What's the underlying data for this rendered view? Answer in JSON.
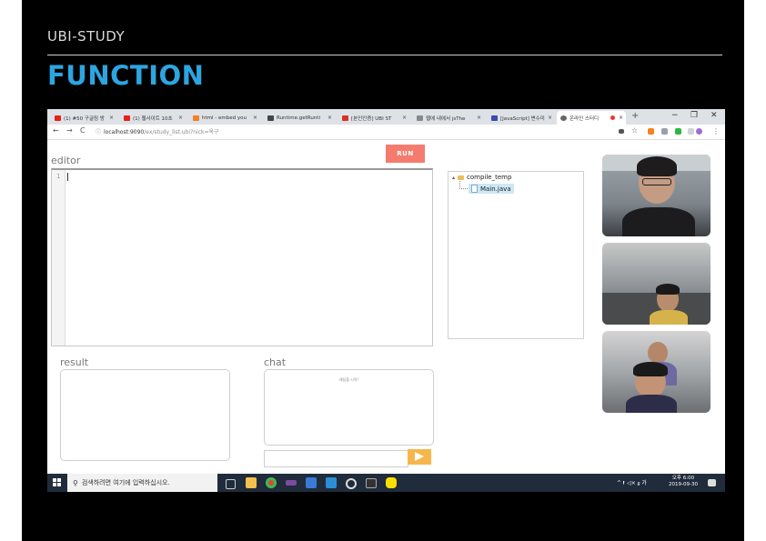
{
  "slide": {
    "label": "UBI-STUDY",
    "title": "FUNCTION"
  },
  "browser": {
    "tabs": [
      {
        "label": "(1) #50 구글링 방",
        "favicon": "youtube-icon",
        "color": "#e62117"
      },
      {
        "label": "(1) 웹사이트 10초",
        "favicon": "youtube-icon",
        "color": "#e62117"
      },
      {
        "label": "html - embed you",
        "favicon": "stackoverflow-icon",
        "color": "#f48024"
      },
      {
        "label": "Runtime.getRunti",
        "favicon": "dev-icon",
        "color": "#444444"
      },
      {
        "label": "[본인인증] UBI ST",
        "favicon": "gmail-icon",
        "color": "#d93025"
      },
      {
        "label": "웹에 내에서 jsThe",
        "favicon": "page-icon",
        "color": "#888888"
      },
      {
        "label": "[JavaScript] 변수미",
        "favicon": "blog-icon",
        "color": "#3b4bb0"
      },
      {
        "label": "온라인 스터디",
        "favicon": "globe-icon",
        "color": "#666666"
      }
    ],
    "new_tab": "+",
    "window_controls": {
      "minimize": "−",
      "restore": "❐",
      "close": "✕"
    },
    "nav": {
      "back": "←",
      "forward": "→",
      "reload": "C"
    },
    "url_host": "localhost:9090",
    "url_path": "/ex/study_list.ubi?nick=옥구"
  },
  "app": {
    "run_label": "RUN",
    "editor_label": "editor",
    "line_number": "1",
    "tree": {
      "root": "compile_temp",
      "child": "Main.java"
    },
    "result_label": "result",
    "chat_label": "chat",
    "chat_message": "채팅을 시작!",
    "input_placeholder": ""
  },
  "taskbar": {
    "search_placeholder": "검색하려면 여기에 입력하십시오.",
    "tray_text": "^ 🖡 ◁× 𝑔 가",
    "time": "오후 6:00",
    "date": "2019-09-30"
  },
  "colors": {
    "accent": "#2ca5e0",
    "run_button": "#f47c6e",
    "send_button": "#f7b64c",
    "taskbar": "#202c3b"
  }
}
